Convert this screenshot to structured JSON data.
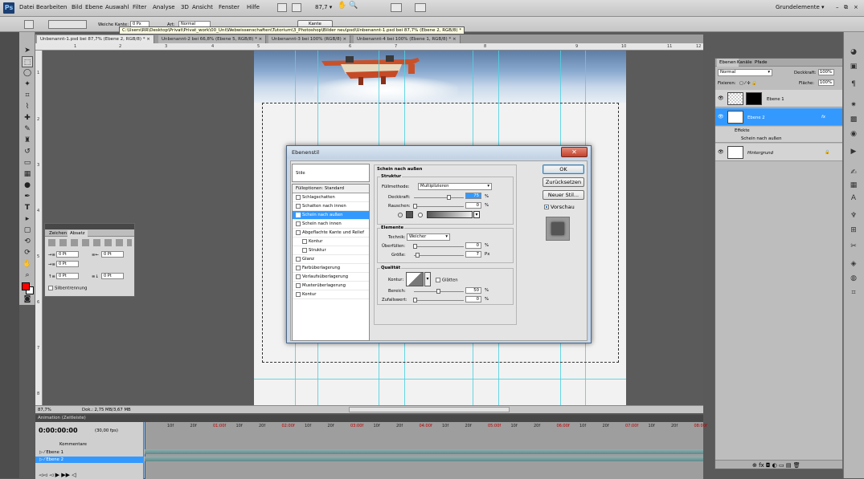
{
  "app": {
    "logo": "Ps",
    "workspace": "Grundelemente ▾",
    "win_min": "–",
    "win_restore": "⧉",
    "win_close": "×"
  },
  "menu": [
    "Datei",
    "Bearbeiten",
    "Bild",
    "Ebene",
    "Auswahl",
    "Filter",
    "Analyse",
    "3D",
    "Ansicht",
    "Fenster",
    "Hilfe"
  ],
  "menu_zoom": "87,7 ▾",
  "options": {
    "feather_label": "Weiche Kante:",
    "feather_value": "0 Px",
    "style_label": "Art:",
    "style_value": "Normal",
    "refine_edge": "Kante verbessern..."
  },
  "path_tooltip": "C:\\Users\\RR\\Desktop\\Privat\\Privat_work\\00_Uni\\Webwissenschaften\\Tutorium\\3_Photoshop\\Bilder neu\\psd\\Unbenannt-1.psd bei 87,7% (Ebene 2, RGB/8) *",
  "doc_tabs": [
    "Unbenannt-1.psd bei 87,7% (Ebene 2, RGB/8) * ×",
    "Unbenannt-2 bei 66,8% (Ebene 5, RGB/8) * ×",
    "Unbenannt-3 bei 100% (RGB/8) ×",
    "Unbenannt-4 bei 100% (Ebene 1, RGB/8) * ×"
  ],
  "ruler_top": [
    "1",
    "2",
    "3",
    "4",
    "5",
    "6",
    "7",
    "8",
    "9",
    "10",
    "11",
    "12"
  ],
  "ruler_left": [
    "1",
    "2",
    "3",
    "4",
    "5",
    "6",
    "7",
    "8"
  ],
  "status": {
    "zoom": "87,7%",
    "doc": "Dok.: 2,75 MB/3,67 MB"
  },
  "zeichen": {
    "tab_zeichen": "Zeichen",
    "tab_absatz": "Absatz",
    "indent_left": "0 Pt",
    "indent_right": "0 Pt",
    "indent_first": "0 Pt",
    "space_before": "0 Pt",
    "space_after": "0 Pt",
    "hyphen": "Silbentrennung"
  },
  "dialog": {
    "title": "Ebenenstil",
    "close": "✕",
    "styles_header": "Stile",
    "styles": [
      {
        "label": "Fülloptionen: Standard",
        "check": false,
        "selected": false,
        "indent": false,
        "head": true
      },
      {
        "label": "Schlagschatten",
        "check": true,
        "selected": false,
        "indent": false,
        "head": false
      },
      {
        "label": "Schatten nach innen",
        "check": true,
        "selected": false,
        "indent": false,
        "head": false
      },
      {
        "label": "Schein nach außen",
        "check": true,
        "selected": true,
        "indent": false,
        "head": false
      },
      {
        "label": "Schein nach innen",
        "check": true,
        "selected": false,
        "indent": false,
        "head": false
      },
      {
        "label": "Abgeflachte Kante und Relief",
        "check": true,
        "selected": false,
        "indent": false,
        "head": false
      },
      {
        "label": "Kontur",
        "check": true,
        "selected": false,
        "indent": true,
        "head": false
      },
      {
        "label": "Struktur",
        "check": true,
        "selected": false,
        "indent": true,
        "head": false
      },
      {
        "label": "Glanz",
        "check": true,
        "selected": false,
        "indent": false,
        "head": false
      },
      {
        "label": "Farbüberlagerung",
        "check": true,
        "selected": false,
        "indent": false,
        "head": false
      },
      {
        "label": "Verlaufsüberlagerung",
        "check": true,
        "selected": false,
        "indent": false,
        "head": false
      },
      {
        "label": "Musterüberlagerung",
        "check": true,
        "selected": false,
        "indent": false,
        "head": false
      },
      {
        "label": "Kontur",
        "check": true,
        "selected": false,
        "indent": false,
        "head": false
      }
    ],
    "section_title": "Schein nach außen",
    "struktur": {
      "title": "Struktur",
      "mode_label": "Füllmethode:",
      "mode_value": "Multiplizieren",
      "opacity_label": "Deckkraft:",
      "opacity_value": "75",
      "noise_label": "Rauschen:",
      "noise_value": "0",
      "unit_pct": "%"
    },
    "elemente": {
      "title": "Elemente",
      "technique_label": "Technik:",
      "technique_value": "Weicher",
      "spread_label": "Überfüllen:",
      "spread_value": "0",
      "size_label": "Größe:",
      "size_value": "7",
      "unit_pct": "%",
      "unit_px": "Px"
    },
    "qualitaet": {
      "title": "Qualität",
      "contour_label": "Kontur:",
      "smooth_label": "Glätten",
      "range_label": "Bereich:",
      "range_value": "50",
      "jitter_label": "Zufallswert:",
      "jitter_value": "0",
      "unit_pct": "%"
    },
    "buttons": {
      "ok": "OK",
      "reset": "Zurücksetzen",
      "new_style": "Neuer Stil...",
      "preview": "Vorschau"
    }
  },
  "layers": {
    "tabs": [
      "Ebenen",
      "Kanäle",
      "Pfade"
    ],
    "blend": "Normal",
    "opacity_label": "Deckkraft:",
    "opacity_value": "100%",
    "lock_label": "Fixieren:",
    "fill_label": "Fläche:",
    "fill_value": "100%",
    "rows": [
      {
        "name": "Ebene 1",
        "selected": false
      },
      {
        "name": "Ebene 2",
        "selected": true
      },
      {
        "name": "Hintergrund",
        "selected": false
      }
    ],
    "effects_label": "Effekte",
    "effect_item": "Schein nach außen",
    "fx": "fx"
  },
  "animation": {
    "title": "Animation (Zeitleiste)",
    "time": "0:00:00:00",
    "fps": "(30,00 fps)",
    "comments": "Kommentare",
    "layer1": "Ebene 1",
    "layer2": "Ebene 2",
    "ticks": [
      "10f",
      "20f",
      "01:00f",
      "10f",
      "20f",
      "02:00f",
      "10f",
      "20f",
      "03:00f",
      "10f",
      "20f",
      "04:00f",
      "10f",
      "20f",
      "05:00f",
      "10f",
      "20f",
      "06:00f",
      "10f",
      "20f",
      "07:00f",
      "10f",
      "20f",
      "08:00f"
    ]
  }
}
